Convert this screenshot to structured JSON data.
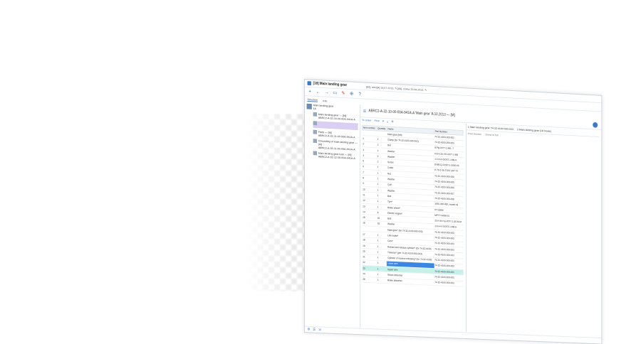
{
  "window": {
    "title": "[18] Main landing gear",
    "breadcrumb": "[85], aircr[A] 18.07.2013, ✎   [85], cr/Acr 20.08.2013, ✎"
  },
  "toolbar": {
    "icons": [
      "add-icon",
      "back-icon",
      "forward-icon",
      "folder-icon",
      "tools-icon",
      "link-icon",
      "help-icon"
    ]
  },
  "tabs": [
    {
      "label": "Structure"
    },
    {
      "label": "Info"
    }
  ],
  "left_tree": {
    "root": {
      "line1": "Main landing gear",
      "line2": "18"
    },
    "items": [
      {
        "line1": "Main landing gear — [M]",
        "line2": "ABRC2-A-32-10-00-00A-941A-A"
      },
      {
        "line1": "",
        "line2": ""
      },
      {
        "line1": "Pads — [M]",
        "line2": "ABRC2-A-32-11-00-00A-941A-A"
      },
      {
        "line1": "Grounding of main landing gear — [M]",
        "line2": "ABRC2-A-32-11-00-00A-941A-A"
      },
      {
        "line1": "Main landing gear lock — [M]",
        "line2": "ABRC2-A-32-12-00-00A-941A-A"
      }
    ]
  },
  "main": {
    "header": "ABRC2-A-32-10-00-00A-941A-A 'Main gear 'A 10.2013 — [M]",
    "grid_toolbar": {
      "order": "To order",
      "find": "Find"
    },
    "columns": [
      "Item number",
      "Quantity",
      "Name",
      "Part Number"
    ],
    "rows": [
      [
        "",
        "",
        "Main gear (left)",
        "74-32-4100-000-002"
      ],
      [
        "1",
        "1",
        "Clamp (for 74-32-4100-000-002)",
        "74-32-4100-000-003"
      ],
      [
        "2",
        "2",
        "Nut",
        "8-Pip-0077-1-M8...7"
      ],
      [
        "3",
        "2",
        "Washer",
        "0.8-H-2h-VG-0077-1-M8"
      ],
      [
        "4",
        "2",
        "Washer",
        "1.3-H-H-GOST-1-M8-H"
      ],
      [
        "5",
        "2",
        "Screw",
        "8-M8-Q-GOST-1-0000-00"
      ],
      [
        "6",
        "1",
        "Cotter",
        "K-70-2-06-TOST-397-70"
      ],
      [
        "7",
        "1",
        "Nut",
        "74-32-4100-000-005"
      ],
      [
        "8",
        "1",
        "Washer",
        "74-32-4100-000-005"
      ],
      [
        "9",
        "1",
        "Cuff",
        "74-32-4100-000-006"
      ],
      [
        "10",
        "1",
        "Washer",
        "74-32-4100-000-007"
      ],
      [
        "11",
        "1",
        "Bolt",
        "74-32-4100-000-008"
      ],
      [
        "12",
        "1",
        "Tyre*",
        "1000-300-460, model 4a"
      ],
      [
        "13",
        "1",
        "Brake wheel*",
        "KT-166M"
      ],
      [
        "14",
        "8",
        "Electric engine*",
        "MPTT-040M-01"
      ],
      [
        "15",
        "16",
        "Bolt",
        "23-H-M-H-p-0077-1-50-M-M"
      ],
      [
        "16",
        "16",
        "Washer",
        "1.8-H-H-GOST-1-M8-H"
      ],
      [
        "",
        "",
        "Main gear* (for 74-32-4100-000-003)",
        "74-32-4100-000-003"
      ],
      [
        "17",
        "1",
        "Link brake*",
        "74-32-4100-000-003"
      ],
      [
        "18",
        "1",
        "Cam*",
        "74-32-4100-000-003"
      ],
      [
        "19",
        "1",
        "Retract and release cylinder* (for 74-32-4100)",
        "74-32-4100-000-003"
      ],
      [
        "20",
        "1",
        "Traverse* (per 74-32-4100-000-003)",
        "74-32-4100-000-003"
      ],
      [
        "21",
        "1",
        "Cylinder of reserve releasing* (for 74-32-4100)",
        "74-32-4100-000-003"
      ],
      [
        "22",
        "1",
        "Lower arm",
        "74-32-4100-000-003"
      ],
      [
        "23",
        "1",
        "Upper arm",
        "74-32-4100-000-003"
      ],
      [
        "24",
        "1",
        "Shock absorber",
        "74-32-4100-000-003"
      ],
      [
        "25",
        "1",
        "Brake absorber",
        "74-32-4100-000-003"
      ]
    ],
    "right_pane": {
      "tabs": [
        "1 Main landing gear 74-32-4100-000-003",
        "2 Main landing gear (18 mode)"
      ],
      "sub": [
        "Print Screen",
        "Show in full"
      ]
    }
  },
  "status_icons": [
    "settings-icon",
    "list-icon",
    "export-icon"
  ]
}
